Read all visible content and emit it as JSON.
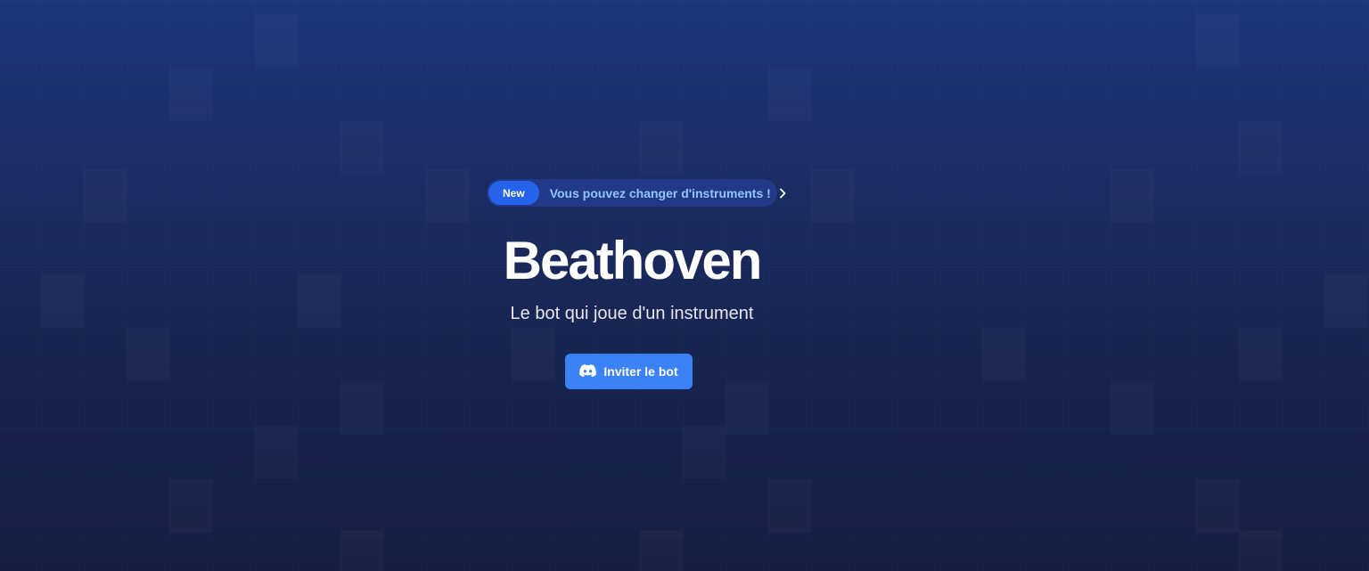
{
  "announcement": {
    "badge": "New",
    "message": "Vous pouvez changer d'instruments !",
    "icon": "chevron-right-icon"
  },
  "hero": {
    "title": "Beathoven",
    "subtitle": "Le bot qui joue d'un instrument"
  },
  "cta": {
    "label": "Inviter le bot",
    "icon": "discord-icon"
  },
  "colors": {
    "background_top": "#1d367c",
    "background_bottom": "#141f40",
    "badge": "#2563eb",
    "announcement_text": "#93c5fd",
    "button": "#3b82f6"
  }
}
